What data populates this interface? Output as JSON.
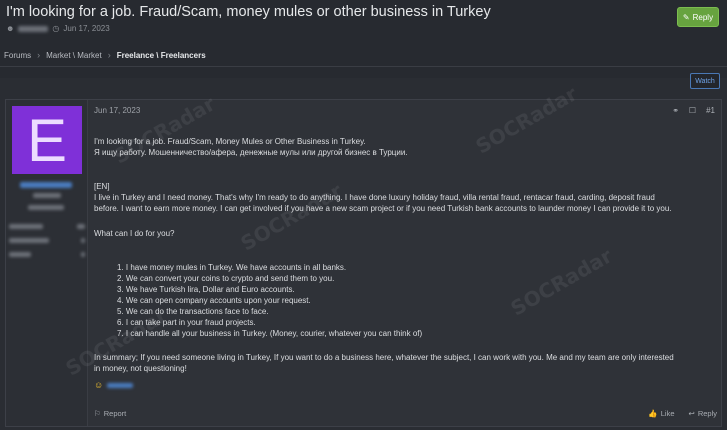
{
  "thread": {
    "title": "I'm looking for a job. Fraud/Scam, money mules or other business in Turkey",
    "date": "Jun 17, 2023",
    "reply_label": "Reply",
    "watch_label": "Watch"
  },
  "breadcrumb": [
    "Forums",
    "Market \\ Market",
    "Freelance \\ Freelancers"
  ],
  "post": {
    "avatar_letter": "E",
    "avatar_color": "#7f30d8",
    "date": "Jun 17, 2023",
    "post_number": "#1",
    "stats": [
      {
        "value": "14"
      },
      {
        "value": "0"
      },
      {
        "value": "0"
      }
    ],
    "lines": [
      "I'm looking for a job. Fraud/Scam, Money Mules or Other Business in Turkey.",
      "Я ищу работу. Мошенничество/афера, денежные мулы или другой бизнес в Турции.",
      "[EN]",
      "I live in Turkey and I need money. That's why I'm ready to do anything. I have done luxury holiday fraud, villa rental fraud, rentacar fraud, carding, deposit fraud",
      "before. I want to earn more money. I can get involved if you have a new scam project or if you need Turkish bank accounts to launder money I can provide it to you.",
      "What can I do for you?"
    ],
    "list": [
      "1. I have money mules in Turkey. We have accounts in all banks.",
      "2. We can convert your coins to crypto and send them to you.",
      "3. We have Turkish lira, Dollar and Euro accounts.",
      "4. We can open company accounts upon your request.",
      "5. We can do the transactions face to face.",
      "6. I can take part in your fraud projects.",
      "7. I can handle all your business in Turkey. (Money, courier, whatever you can think of)"
    ],
    "summary": [
      "In summary; If you need someone living in Turkey, If you want to do a business here, whatever the subject, I can work with you. Me and my team are only interested",
      "in money, not questioning!"
    ],
    "report_label": "Report",
    "like_label": "Like",
    "reply_label": "Reply"
  },
  "watermark_text": "SOCRadar"
}
